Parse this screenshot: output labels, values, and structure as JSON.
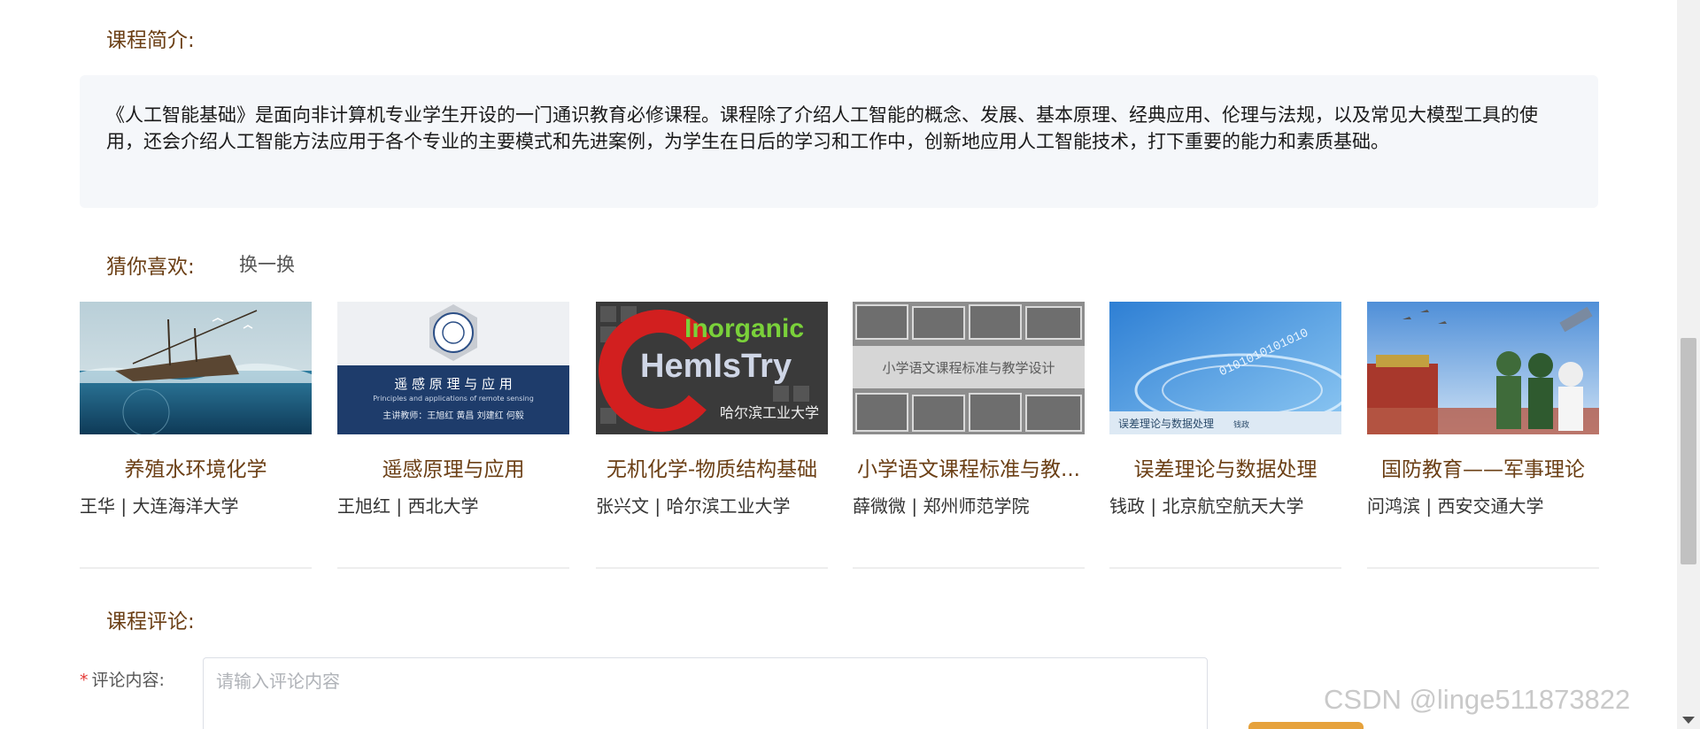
{
  "intro": {
    "title": "课程简介:",
    "text": "《人工智能基础》是面向非计算机专业学生开设的一门通识教育必修课程。课程除了介绍人工智能的概念、发展、基本原理、经典应用、伦理与法规，以及常见大模型工具的使用，还会介绍人工智能方法应用于各个专业的主要模式和先进案例，为学生在日后的学习和工作中，创新地应用人工智能技术，打下重要的能力和素质基础。"
  },
  "recommend": {
    "title": "猜你喜欢:",
    "refresh_label": "换一换",
    "courses": [
      {
        "title": "养殖水环境化学",
        "meta": "王华 | 大连海洋大学"
      },
      {
        "title": "遥感原理与应用",
        "meta": "王旭红 | 西北大学",
        "thumb_text": "遥 感 原 理 与 应 用",
        "thumb_sub": "Principles and applications of remote sensing",
        "thumb_sub2": "主讲教师：王旭红 黄昌 刘建红 何毅"
      },
      {
        "title": "无机化学-物质结构基础",
        "meta": "张兴文 | 哈尔滨工业大学",
        "thumb_text": "Inorganic",
        "thumb_text2": "HemIsTry",
        "thumb_sub": "哈尔滨工业大学"
      },
      {
        "title": "小学语文课程标准与教...",
        "meta": "薛微微 | 郑州师范学院",
        "thumb_text": "小学语文课程标准与教学设计"
      },
      {
        "title": "误差理论与数据处理",
        "meta": "钱政 | 北京航空航天大学",
        "thumb_text": "误差理论与数据处理",
        "thumb_sub": "钱政",
        "thumb_bits": "0101010101010"
      },
      {
        "title": "国防教育——军事理论",
        "meta": "问鸿滨 | 西安交通大学"
      }
    ]
  },
  "comments": {
    "title": "课程评论:",
    "label": "评论内容:",
    "required_mark": "*",
    "placeholder": "请输入评论内容"
  },
  "watermark": "CSDN @linge511873822",
  "colors": {
    "heading": "#6b3f15",
    "intro_bg": "#f5f7fa",
    "button": "#e6a23c"
  }
}
